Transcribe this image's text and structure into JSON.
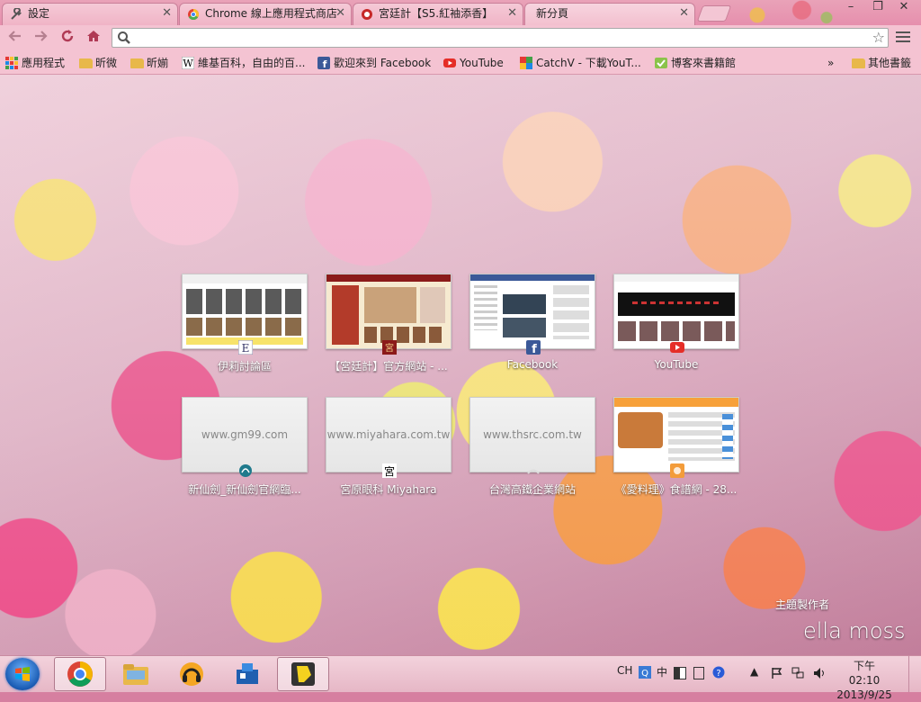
{
  "tabs": [
    {
      "label": "設定",
      "icon": "wrench-icon"
    },
    {
      "label": "Chrome 線上應用程式商店",
      "icon": "chrome-store-icon"
    },
    {
      "label": "宮廷計【S5.紅袖添香】",
      "icon": "site-icon"
    },
    {
      "label": "新分頁",
      "icon": ""
    }
  ],
  "window_controls": {
    "minimize": "–",
    "maximize": "❐",
    "close": "✕"
  },
  "omnibox": {
    "value": "",
    "placeholder": ""
  },
  "bookmarks": [
    {
      "label": "應用程式",
      "icon": "apps-grid-icon"
    },
    {
      "label": "昕微",
      "icon": "folder-icon"
    },
    {
      "label": "昕媊",
      "icon": "folder-icon"
    },
    {
      "label": "維基百科，自由的百...",
      "icon": "wikipedia-icon"
    },
    {
      "label": "歡迎來到 Facebook",
      "icon": "facebook-icon"
    },
    {
      "label": "YouTube",
      "icon": "youtube-icon"
    },
    {
      "label": "CatchV - 下載YouT...",
      "icon": "catchv-icon"
    },
    {
      "label": "博客來書籍館",
      "icon": "books-icon"
    }
  ],
  "bookmarks_overflow": "»",
  "other_bookmarks": "其他書籤",
  "tiles": [
    {
      "title": "伊莉討論區",
      "url": ""
    },
    {
      "title": "【宮廷計】官方網站 - ...",
      "url": ""
    },
    {
      "title": "Facebook",
      "url": ""
    },
    {
      "title": "YouTube",
      "url": ""
    },
    {
      "title": "新仙劍_新仙劍官網臨...",
      "url": "www.gm99.com"
    },
    {
      "title": "宮原眼科 Miyahara",
      "url": "www.miyahara.com.tw"
    },
    {
      "title": "台灣高鐵企業網站",
      "url": "www.thsrc.com.tw"
    },
    {
      "title": "《愛料理》食譜網 - 28...",
      "url": ""
    }
  ],
  "theme_credit": {
    "label": "主題製作者",
    "author": "ella moss"
  },
  "taskbar": {
    "tray": {
      "lang": "CH",
      "ime": "中"
    },
    "clock": {
      "time": "下午 02:10",
      "date": "2013/9/25"
    }
  }
}
